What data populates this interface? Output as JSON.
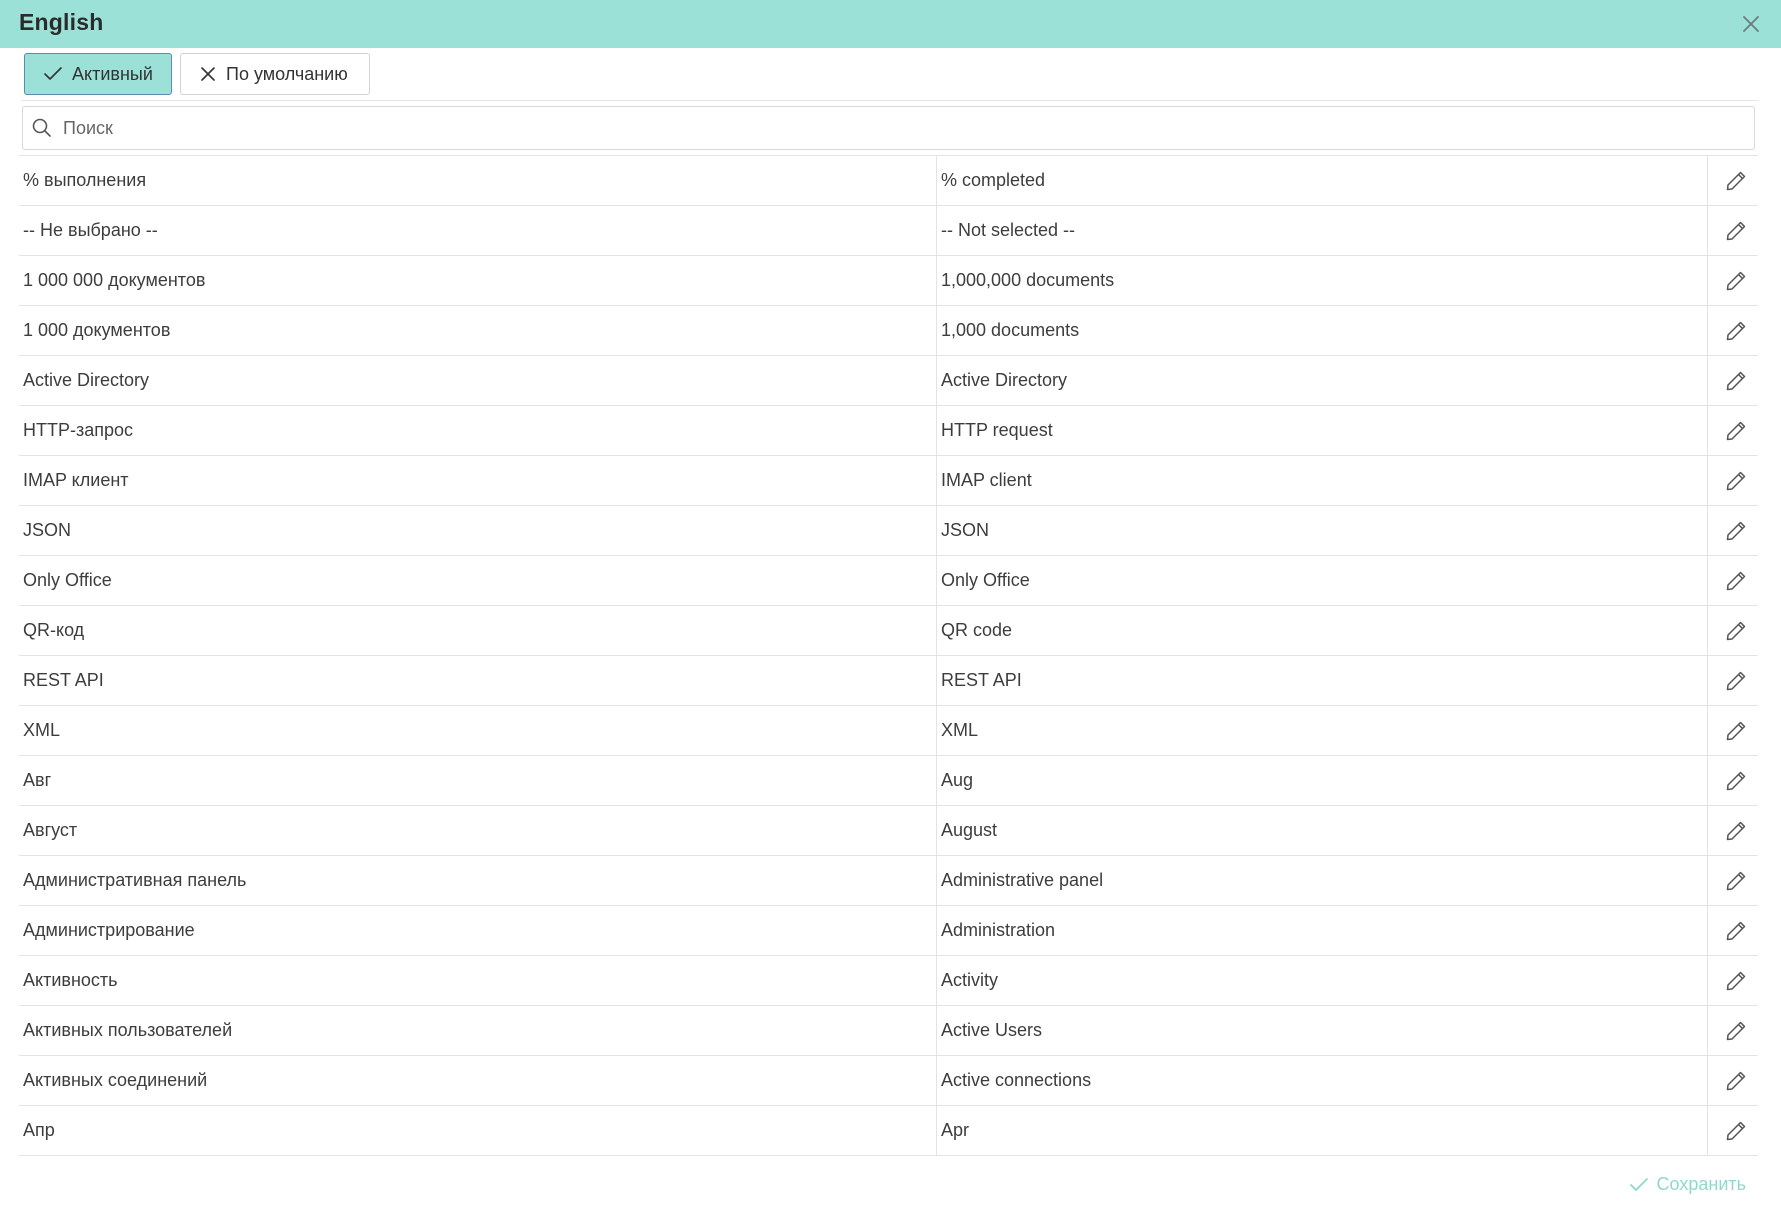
{
  "dialog": {
    "title": "English"
  },
  "toolbar": {
    "active_label": "Активный",
    "default_label": "По умолчанию"
  },
  "search": {
    "placeholder": "Поиск",
    "value": ""
  },
  "rows": [
    {
      "source": "% выполнения",
      "translation": "% completed"
    },
    {
      "source": "-- Не выбрано --",
      "translation": "-- Not selected --"
    },
    {
      "source": "1 000 000 документов",
      "translation": "1,000,000 documents"
    },
    {
      "source": "1 000 документов",
      "translation": "1,000 documents"
    },
    {
      "source": "Active Directory",
      "translation": "Active Directory"
    },
    {
      "source": "HTTP-запрос",
      "translation": "HTTP request"
    },
    {
      "source": "IMAP клиент",
      "translation": "IMAP client"
    },
    {
      "source": "JSON",
      "translation": "JSON"
    },
    {
      "source": "Only Office",
      "translation": "Only Office"
    },
    {
      "source": "QR-код",
      "translation": "QR code"
    },
    {
      "source": "REST API",
      "translation": "REST API"
    },
    {
      "source": "XML",
      "translation": "XML"
    },
    {
      "source": "Авг",
      "translation": "Aug"
    },
    {
      "source": "Август",
      "translation": "August"
    },
    {
      "source": "Административная панель",
      "translation": "Administrative panel"
    },
    {
      "source": "Администрирование",
      "translation": "Administration"
    },
    {
      "source": "Активность",
      "translation": "Activity"
    },
    {
      "source": "Активных пользователей",
      "translation": "Active Users"
    },
    {
      "source": "Активных соединений",
      "translation": "Active connections"
    },
    {
      "source": "Апр",
      "translation": "Apr"
    }
  ],
  "footer": {
    "save_label": "Сохранить"
  },
  "colors": {
    "header_bg": "#9be1d8",
    "active_border": "#5a8bb0",
    "save_text": "#8fd8cd",
    "grid_line": "#e3e3e3"
  },
  "icons": {
    "close": "close-icon",
    "check": "check-icon",
    "cross": "x-icon",
    "search": "search-icon",
    "edit": "pencil-icon",
    "save": "check-icon"
  }
}
